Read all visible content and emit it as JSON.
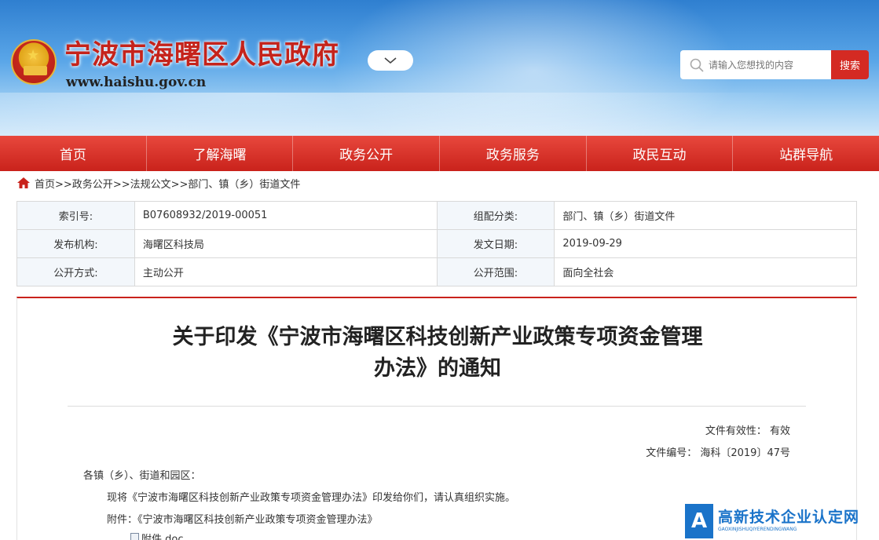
{
  "header": {
    "site_title": "宁波市海曙区人民政府",
    "site_url": "www.haishu.gov.cn",
    "search": {
      "placeholder": "请输入您想找的内容",
      "button_label": "搜索"
    }
  },
  "nav": {
    "items": [
      "首页",
      "了解海曙",
      "政务公开",
      "政务服务",
      "政民互动",
      "站群导航"
    ]
  },
  "breadcrumb": {
    "home": "首页",
    "trail": [
      ">>政务公开",
      ">>法规公文",
      ">>部门、镇（乡）街道文件"
    ]
  },
  "info": {
    "index_no_label": "索引号:",
    "index_no": "B07608932/2019-00051",
    "category_label": "组配分类:",
    "category": "部门、镇（乡）街道文件",
    "issuer_label": "发布机构:",
    "issuer": "海曙区科技局",
    "date_label": "发文日期:",
    "date": "2019-09-29",
    "disclosure_label": "公开方式:",
    "disclosure": "主动公开",
    "scope_label": "公开范围:",
    "scope": "面向全社会"
  },
  "article": {
    "title_line1": "关于印发《宁波市海曙区科技创新产业政策专项资金管理",
    "title_line2": "办法》的通知",
    "validity": "文件有效性：  有效",
    "doc_no": "文件编号：  海科〔2019〕47号",
    "salutation": "各镇（乡）、街道和园区：",
    "para1": "现将《宁波市海曙区科技创新产业政策专项资金管理办法》印发给你们，请认真组织实施。",
    "attachment_line": "附件：《宁波市海曙区科技创新产业政策专项资金管理办法》",
    "attachment_file": "附件.doc"
  },
  "watermark": {
    "mark": "A",
    "cn": "高新技术企业认定网",
    "en": "GAOXINJISHUQIYERENDINGWANG"
  },
  "colors": {
    "brand_red": "#c9221b",
    "banner_blue": "#2f7fd0",
    "watermark_blue": "#1a73c9"
  }
}
